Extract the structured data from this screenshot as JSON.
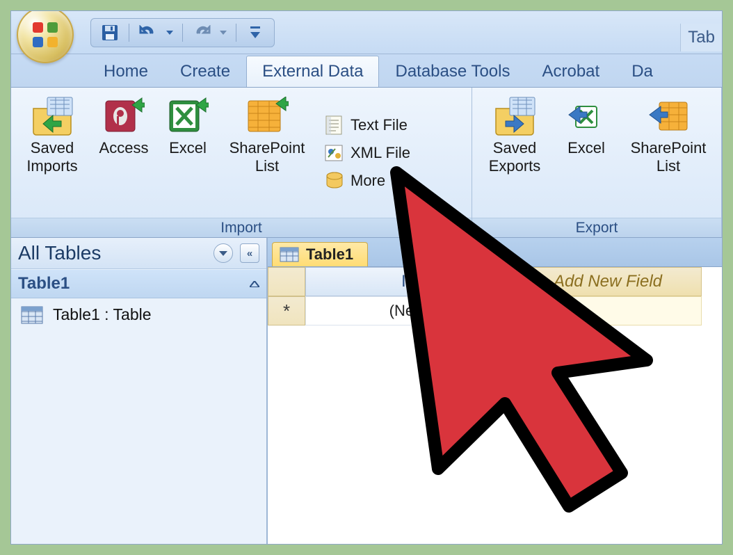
{
  "titlebar": {
    "extra_tab": "Tab"
  },
  "tabs": {
    "home": "Home",
    "create": "Create",
    "external_data": "External Data",
    "database_tools": "Database Tools",
    "acrobat": "Acrobat",
    "datasheet_partial": "Da"
  },
  "ribbon": {
    "import": {
      "label": "Import",
      "saved_imports_l1": "Saved",
      "saved_imports_l2": "Imports",
      "access": "Access",
      "excel": "Excel",
      "sharepoint_l1": "SharePoint",
      "sharepoint_l2": "List",
      "text_file": "Text File",
      "xml_file": "XML File",
      "more": "More"
    },
    "export": {
      "label": "Export",
      "saved_exports_l1": "Saved",
      "saved_exports_l2": "Exports",
      "excel": "Excel",
      "sharepoint_l1": "SharePoint",
      "sharepoint_l2": "List"
    }
  },
  "nav": {
    "header": "All Tables",
    "section": "Table1",
    "item": "Table1 : Table"
  },
  "datasheet": {
    "tab": "Table1",
    "col_id": "ID",
    "col_new": "Add New Field",
    "new_row_symbol": "*",
    "new_id_value": "(New)"
  }
}
